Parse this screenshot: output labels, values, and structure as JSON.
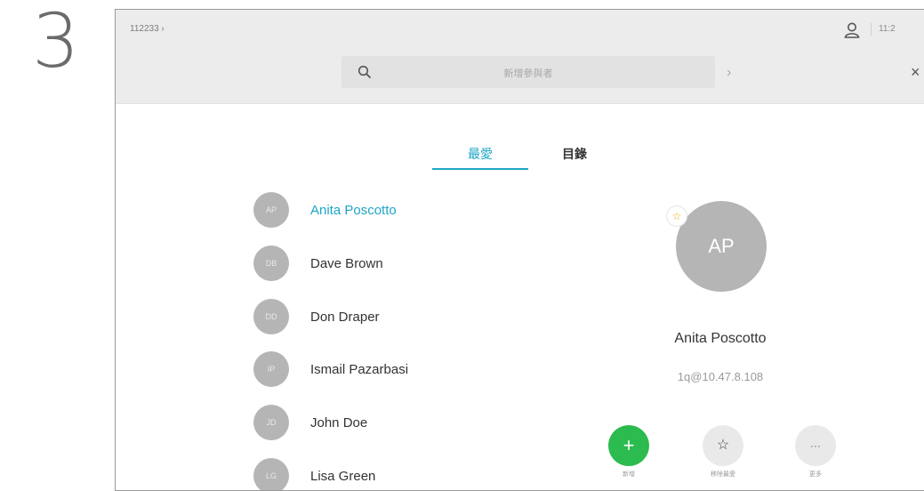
{
  "step": {
    "number": "3"
  },
  "topbar": {
    "breadcrumb": "112233 ›",
    "clock": "11:2",
    "search_placeholder": "新增參與者",
    "forward_chevron": "›",
    "close": "×"
  },
  "tabs": [
    {
      "label": "最愛",
      "active": true
    },
    {
      "label": "目錄",
      "active": false
    }
  ],
  "contacts": [
    {
      "initials": "AP",
      "name": "Anita Poscotto",
      "selected": true
    },
    {
      "initials": "DB",
      "name": "Dave Brown",
      "selected": false
    },
    {
      "initials": "DD",
      "name": "Don Draper",
      "selected": false
    },
    {
      "initials": "IP",
      "name": "Ismail Pazarbasi",
      "selected": false
    },
    {
      "initials": "JD",
      "name": "John Doe",
      "selected": false
    },
    {
      "initials": "LG",
      "name": "Lisa Green",
      "selected": false
    }
  ],
  "detail": {
    "initials": "AP",
    "favorite_badge": "☆",
    "name": "Anita Poscotto",
    "address": "1q@10.47.8.108",
    "actions": {
      "call_icon": "+",
      "call_label": "新增",
      "favorite_icon": "☆",
      "favorite_label": "移除最愛",
      "more_icon": "···",
      "more_label": "更多"
    }
  },
  "colors": {
    "accent": "#1ea6c6",
    "call_green": "#2bbb4e",
    "avatar_gray": "#b5b5b5",
    "topbar_bg": "#ececec"
  }
}
